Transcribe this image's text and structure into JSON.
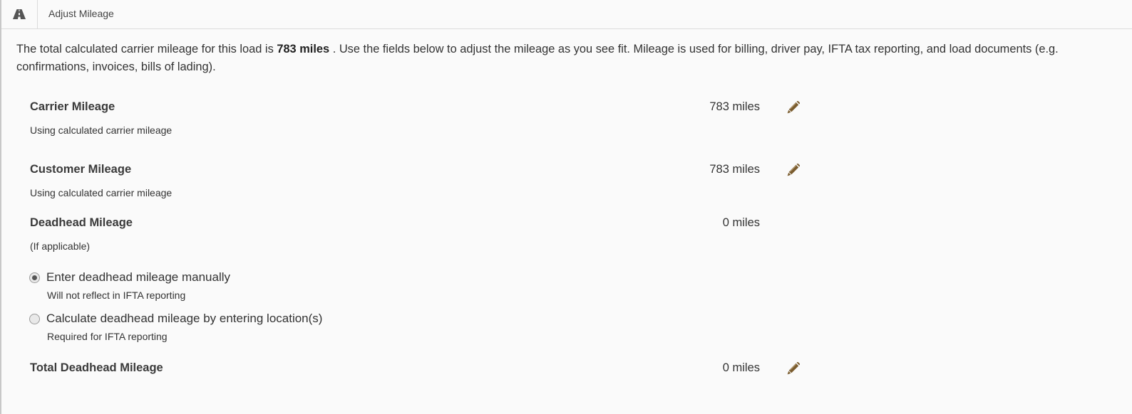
{
  "header": {
    "icon": "road-icon",
    "title": "Adjust Mileage"
  },
  "intro": {
    "before": "The total calculated carrier mileage for this load is ",
    "highlight": "783 miles",
    "after": " . Use the fields below to adjust the mileage as you see fit. Mileage is used for billing, driver pay, IFTA tax reporting, and load documents (e.g. confirmations, invoices, bills of lading)."
  },
  "carrier": {
    "title": "Carrier Mileage",
    "subtitle": "Using calculated carrier mileage",
    "value": "783 miles",
    "edit_icon": "pencil-icon"
  },
  "customer": {
    "title": "Customer Mileage",
    "subtitle": "Using calculated carrier mileage",
    "value": "783 miles",
    "edit_icon": "pencil-icon"
  },
  "deadhead": {
    "title": "Deadhead Mileage",
    "subtitle": "(If applicable)",
    "value": "0 miles",
    "options": [
      {
        "label": "Enter deadhead mileage manually",
        "hint": "Will not reflect in IFTA reporting",
        "selected": true
      },
      {
        "label": "Calculate deadhead mileage by entering location(s)",
        "hint": "Required for IFTA reporting",
        "selected": false
      }
    ]
  },
  "total_deadhead": {
    "title": "Total Deadhead Mileage",
    "value": "0 miles",
    "edit_icon": "pencil-icon"
  },
  "colors": {
    "edit_icon": "#7a5c2e",
    "background": "#fafafa"
  }
}
